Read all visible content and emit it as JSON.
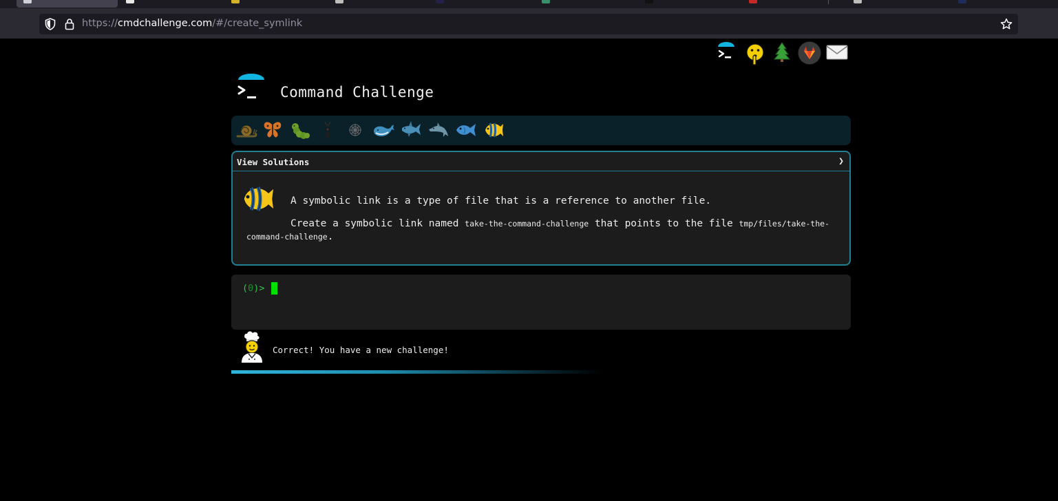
{
  "browser": {
    "url_prefix": "https://",
    "url_host": "cmdchallenge.com",
    "url_path": "/#/create_symlink"
  },
  "top_icons": [
    "terminal-logo-icon",
    "shushing-face-icon",
    "christmas-tree-icon",
    "gitlab-icon",
    "envelope-icon"
  ],
  "site": {
    "title": "Command Challenge"
  },
  "levels": [
    "snail-icon",
    "butterfly-icon",
    "caterpillar-icon",
    "ant-icon",
    "spider-web-icon",
    "whale-icon",
    "shark-icon",
    "dolphin-icon",
    "fish-icon",
    "tropical-fish-icon"
  ],
  "challenge": {
    "solutions_label": "View Solutions",
    "chevron": "❯",
    "description_1": "A symbolic link is a type of file that is a reference to another file.",
    "desc2_a": "Create a symbolic link named ",
    "desc2_code1": "take-the-command-challenge",
    "desc2_b": " that points to the file ",
    "desc2_code2": "tmp/files/take-the-command-challenge",
    "desc2_c": "."
  },
  "terminal": {
    "prompt_open": "(",
    "exit_code": "0",
    "prompt_close": ")>"
  },
  "result": {
    "message": "Correct! You have a new challenge!"
  },
  "colors": {
    "accent": "#1f7f93",
    "prompt": "#33c14a",
    "cursor": "#00e000",
    "level_bar": "#0a2129",
    "progress": "#2fb5d9"
  }
}
